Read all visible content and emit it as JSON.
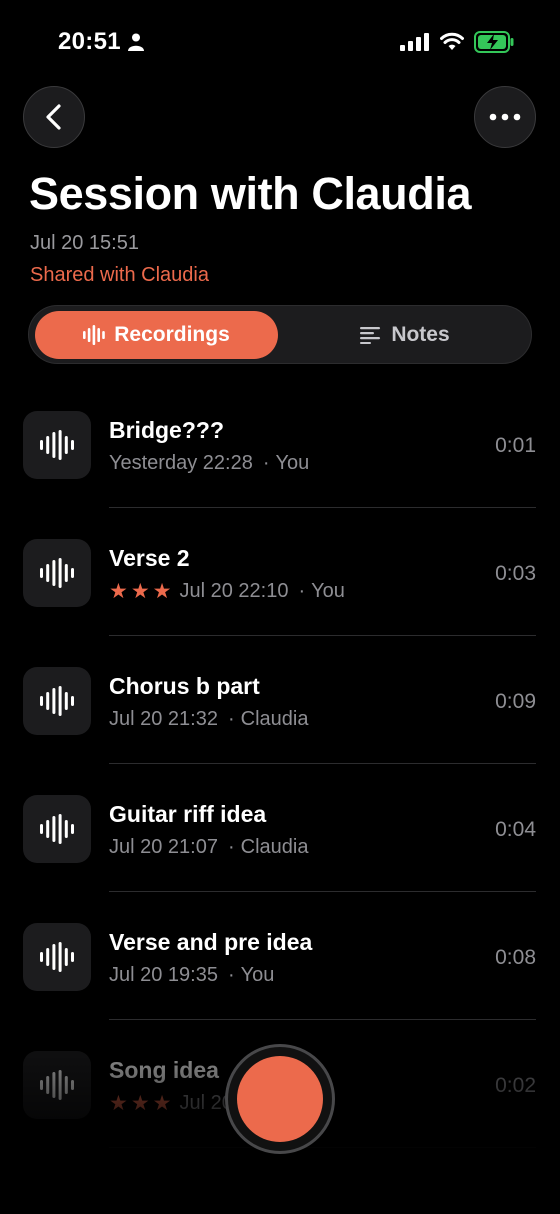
{
  "status_bar": {
    "time": "20:51"
  },
  "header": {
    "title": "Session with Claudia",
    "date": "Jul 20 15:51",
    "shared": "Shared with Claudia"
  },
  "tabs": {
    "recordings": "Recordings",
    "notes": "Notes"
  },
  "recordings": [
    {
      "title": "Bridge???",
      "time": "Yesterday 22:28",
      "author": "You",
      "duration": "0:01",
      "stars": 0
    },
    {
      "title": "Verse 2",
      "time": "Jul 20 22:10",
      "author": "You",
      "duration": "0:03",
      "stars": 3
    },
    {
      "title": "Chorus b part",
      "time": "Jul 20 21:32",
      "author": "Claudia",
      "duration": "0:09",
      "stars": 0
    },
    {
      "title": "Guitar riff idea",
      "time": "Jul 20 21:07",
      "author": "Claudia",
      "duration": "0:04",
      "stars": 0
    },
    {
      "title": "Verse and pre idea",
      "time": "Jul 20 19:35",
      "author": "You",
      "duration": "0:08",
      "stars": 0
    },
    {
      "title": "Song idea",
      "time": "Jul 20 ...",
      "author": "You",
      "duration": "0:02",
      "stars": 3
    }
  ],
  "colors": {
    "accent": "#ec6a4c",
    "background": "#000000",
    "card": "#1c1c1e"
  }
}
